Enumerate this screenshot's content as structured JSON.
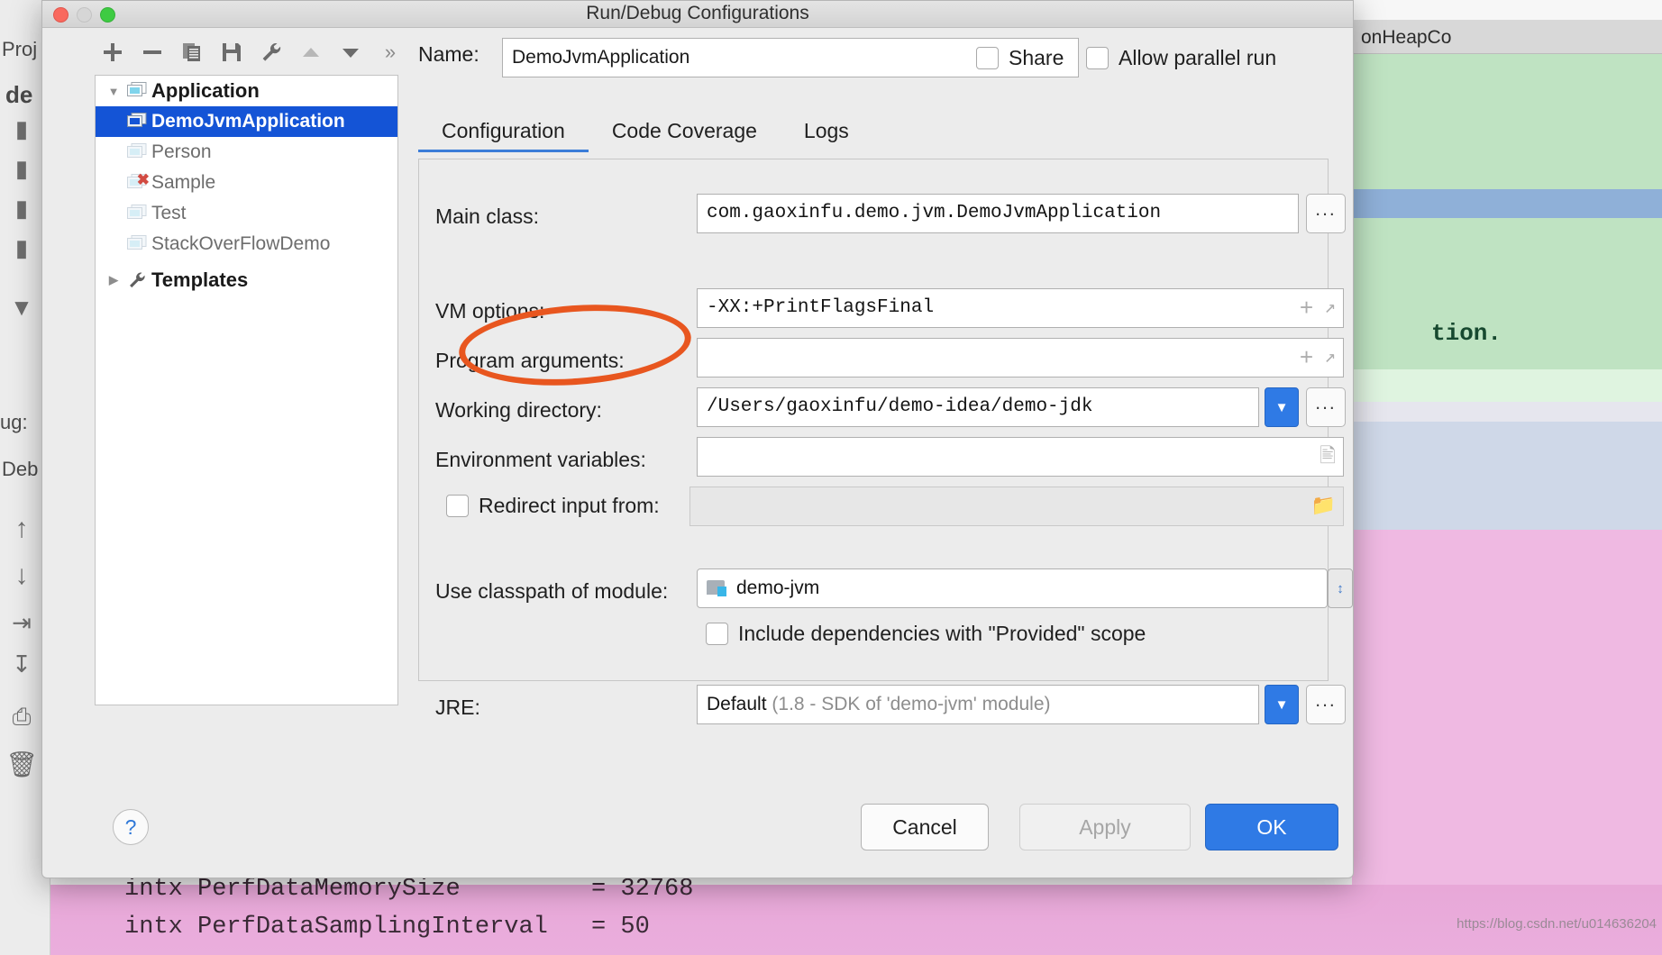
{
  "window": {
    "title": "Run/Debug Configurations",
    "traffic_lights": [
      "close",
      "minimize",
      "zoom"
    ]
  },
  "toolbar": {
    "buttons": [
      {
        "name": "add",
        "glyph": "plus"
      },
      {
        "name": "remove",
        "glyph": "minus"
      },
      {
        "name": "copy",
        "glyph": "copy"
      },
      {
        "name": "save",
        "glyph": "save"
      },
      {
        "name": "edit-templates",
        "glyph": "wrench"
      },
      {
        "name": "move-up",
        "glyph": "triangle-up"
      },
      {
        "name": "move-down",
        "glyph": "triangle-down"
      },
      {
        "name": "more",
        "glyph": "chevrons-right",
        "label": "»"
      }
    ]
  },
  "tree": {
    "root": {
      "label": "Application",
      "expanded": true
    },
    "children": [
      {
        "label": "DemoJvmApplication",
        "selected": true,
        "error": false
      },
      {
        "label": "Person",
        "selected": false,
        "error": false
      },
      {
        "label": "Sample",
        "selected": false,
        "error": true
      },
      {
        "label": "Test",
        "selected": false,
        "error": false
      },
      {
        "label": "StackOverFlowDemo",
        "selected": false,
        "error": false
      }
    ],
    "templates": {
      "label": "Templates",
      "expanded": false
    }
  },
  "name_row": {
    "label": "Name:",
    "value": "DemoJvmApplication",
    "share": {
      "label": "Share",
      "checked": false
    },
    "parallel": {
      "label": "Allow parallel run",
      "checked": false
    }
  },
  "tabs": [
    {
      "label": "Configuration",
      "active": true
    },
    {
      "label": "Code Coverage",
      "active": false
    },
    {
      "label": "Logs",
      "active": false
    }
  ],
  "form": {
    "main_class": {
      "label": "Main class:",
      "value": "com.gaoxinfu.demo.jvm.DemoJvmApplication",
      "browse": "..."
    },
    "vm_options": {
      "label": "VM options:",
      "value": "-XX:+PrintFlagsFinal"
    },
    "program_arguments": {
      "label": "Program arguments:",
      "value": ""
    },
    "working_directory": {
      "label": "Working directory:",
      "value": "/Users/gaoxinfu/demo-idea/demo-jdk",
      "browse": "..."
    },
    "environment_variables": {
      "label": "Environment variables:",
      "value": ""
    },
    "redirect_input": {
      "label": "Redirect input from:",
      "checked": false,
      "value": ""
    },
    "classpath_module": {
      "label": "Use classpath of module:",
      "value": "demo-jvm"
    },
    "include_provided": {
      "label": "Include dependencies with \"Provided\" scope",
      "checked": false
    },
    "jre": {
      "label": "JRE:",
      "value": "Default (1.8 - SDK of 'demo-jvm' module)",
      "value_bold": "Default",
      "value_dim": "(1.8 - SDK of 'demo-jvm' module)",
      "browse": "..."
    }
  },
  "footer": {
    "help": "?",
    "cancel": "Cancel",
    "apply": "Apply",
    "ok": "OK"
  },
  "annotation": {
    "shape": "ellipse",
    "color": "#e8561f",
    "targets": "VM options:"
  },
  "background": {
    "project_label": "Proj",
    "demo_label": "de",
    "debug_label": "ug:",
    "debug_tab": "Deb",
    "right_tab": "onHeapCo",
    "right_text": "tion.",
    "console_lines": [
      {
        "text": "intx PerfDataMemorySize",
        "value": "= 32768"
      },
      {
        "text": "intx PerfDataSamplingInterval",
        "value": "= 50"
      }
    ],
    "watermark": "https://blog.csdn.net/u014636204"
  },
  "colors": {
    "accent": "#2f7ae5",
    "selection": "#1454d6",
    "annotation": "#e8561f",
    "error": "#d24b42"
  }
}
